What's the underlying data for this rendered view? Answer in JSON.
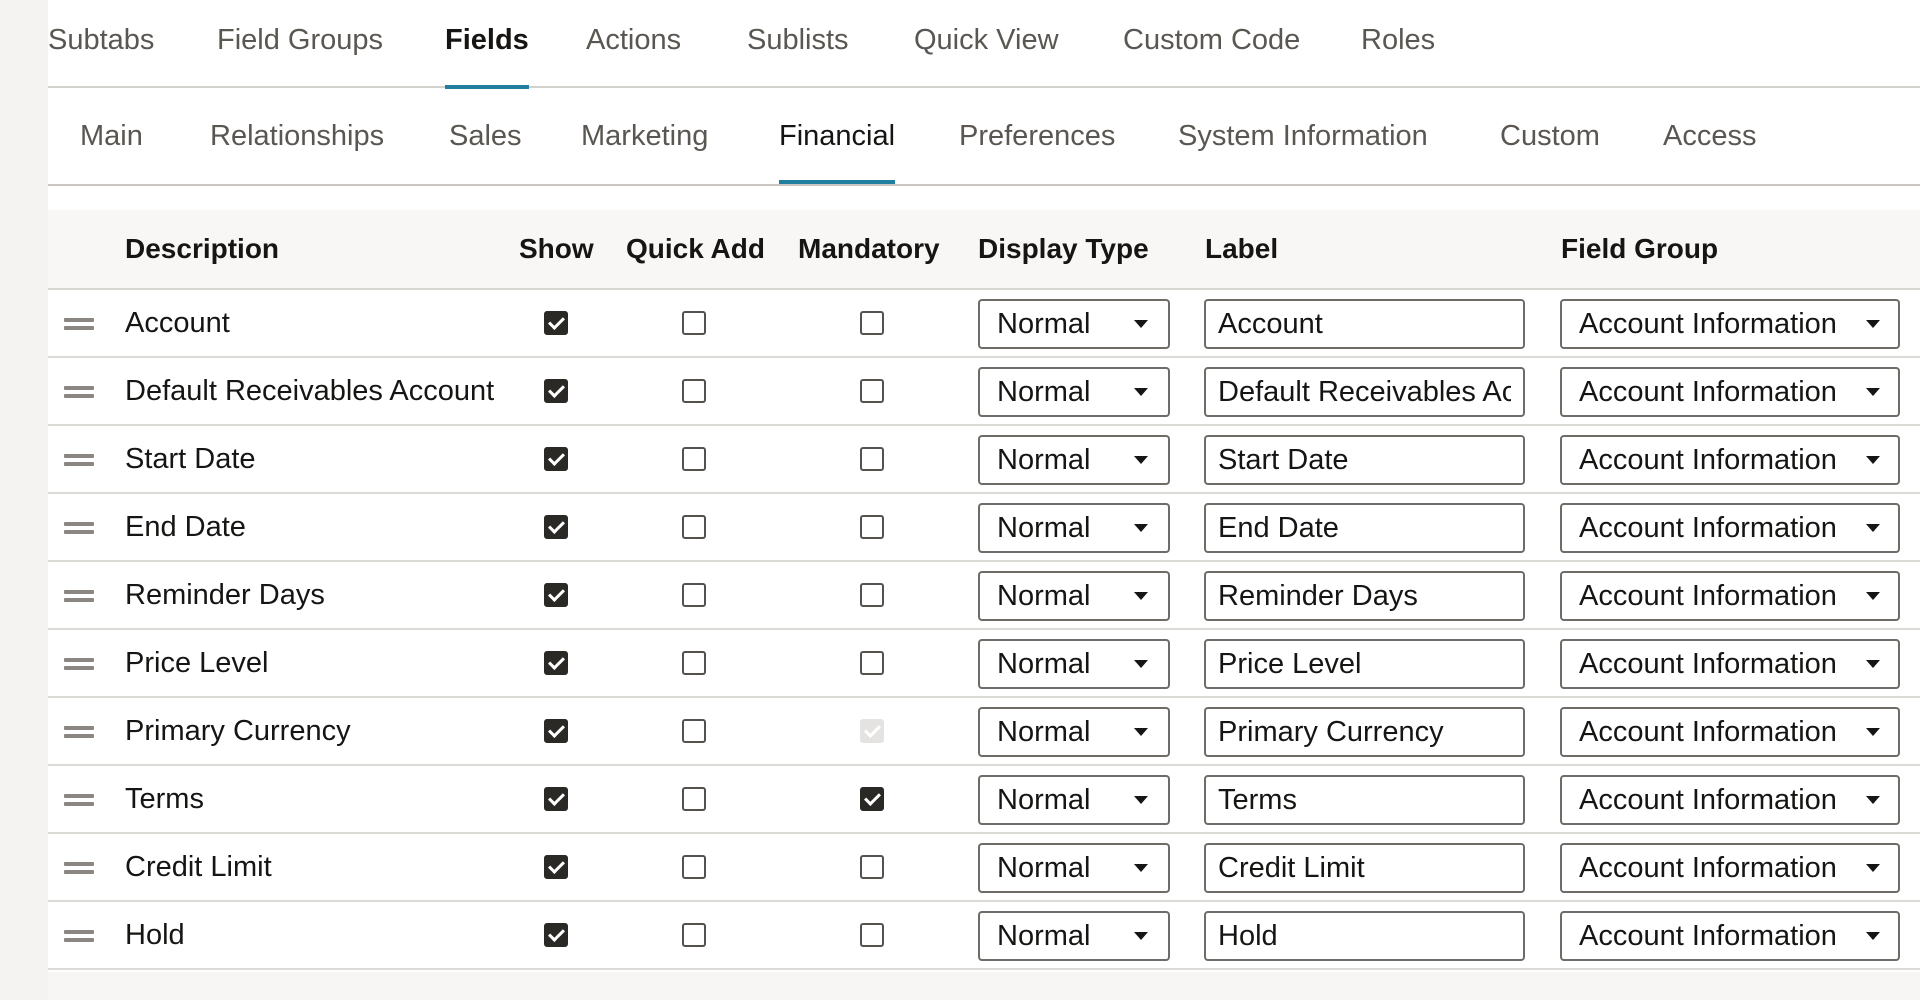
{
  "primary_tabs": [
    {
      "label": "Subtabs",
      "active": false
    },
    {
      "label": "Field Groups",
      "active": false
    },
    {
      "label": "Fields",
      "active": true
    },
    {
      "label": "Actions",
      "active": false
    },
    {
      "label": "Sublists",
      "active": false
    },
    {
      "label": "Quick View",
      "active": false
    },
    {
      "label": "Custom Code",
      "active": false
    },
    {
      "label": "Roles",
      "active": false
    }
  ],
  "secondary_tabs": [
    {
      "label": "Main",
      "active": false
    },
    {
      "label": "Relationships",
      "active": false
    },
    {
      "label": "Sales",
      "active": false
    },
    {
      "label": "Marketing",
      "active": false
    },
    {
      "label": "Financial",
      "active": true
    },
    {
      "label": "Preferences",
      "active": false
    },
    {
      "label": "System Information",
      "active": false
    },
    {
      "label": "Custom",
      "active": false
    },
    {
      "label": "Access",
      "active": false
    }
  ],
  "table": {
    "columns": {
      "description": "Description",
      "show": "Show",
      "quick_add": "Quick Add",
      "mandatory": "Mandatory",
      "display_type": "Display Type",
      "label": "Label",
      "field_group": "Field Group"
    },
    "rows": [
      {
        "description": "Account",
        "show": true,
        "quick_add": false,
        "mandatory": "unchecked",
        "display_type": "Normal",
        "label": "Account",
        "field_group": "Account Information"
      },
      {
        "description": "Default Receivables Account",
        "show": true,
        "quick_add": false,
        "mandatory": "unchecked",
        "display_type": "Normal",
        "label": "Default Receivables Account",
        "field_group": "Account Information"
      },
      {
        "description": "Start Date",
        "show": true,
        "quick_add": false,
        "mandatory": "unchecked",
        "display_type": "Normal",
        "label": "Start Date",
        "field_group": "Account Information"
      },
      {
        "description": "End Date",
        "show": true,
        "quick_add": false,
        "mandatory": "unchecked",
        "display_type": "Normal",
        "label": "End Date",
        "field_group": "Account Information"
      },
      {
        "description": "Reminder Days",
        "show": true,
        "quick_add": false,
        "mandatory": "unchecked",
        "display_type": "Normal",
        "label": "Reminder Days",
        "field_group": "Account Information"
      },
      {
        "description": "Price Level",
        "show": true,
        "quick_add": false,
        "mandatory": "unchecked",
        "display_type": "Normal",
        "label": "Price Level",
        "field_group": "Account Information"
      },
      {
        "description": "Primary Currency",
        "show": true,
        "quick_add": false,
        "mandatory": "checked-disabled",
        "display_type": "Normal",
        "label": "Primary Currency",
        "field_group": "Account Information"
      },
      {
        "description": "Terms",
        "show": true,
        "quick_add": false,
        "mandatory": "checked",
        "display_type": "Normal",
        "label": "Terms",
        "field_group": "Account Information"
      },
      {
        "description": "Credit Limit",
        "show": true,
        "quick_add": false,
        "mandatory": "unchecked",
        "display_type": "Normal",
        "label": "Credit Limit",
        "field_group": "Account Information"
      },
      {
        "description": "Hold",
        "show": true,
        "quick_add": false,
        "mandatory": "unchecked",
        "display_type": "Normal",
        "label": "Hold",
        "field_group": "Account Information"
      }
    ]
  },
  "icons": {
    "drag_handle": "drag-handle-icon",
    "dropdown_caret": "chevron-down-icon",
    "checkbox_checked": "checkmark-icon"
  },
  "colors": {
    "accent": "#227e9e",
    "checkbox_checked": "#2b2926",
    "checkbox_disabled": "#e4e3e1",
    "text_primary": "#161513",
    "text_secondary": "#5a5651"
  }
}
